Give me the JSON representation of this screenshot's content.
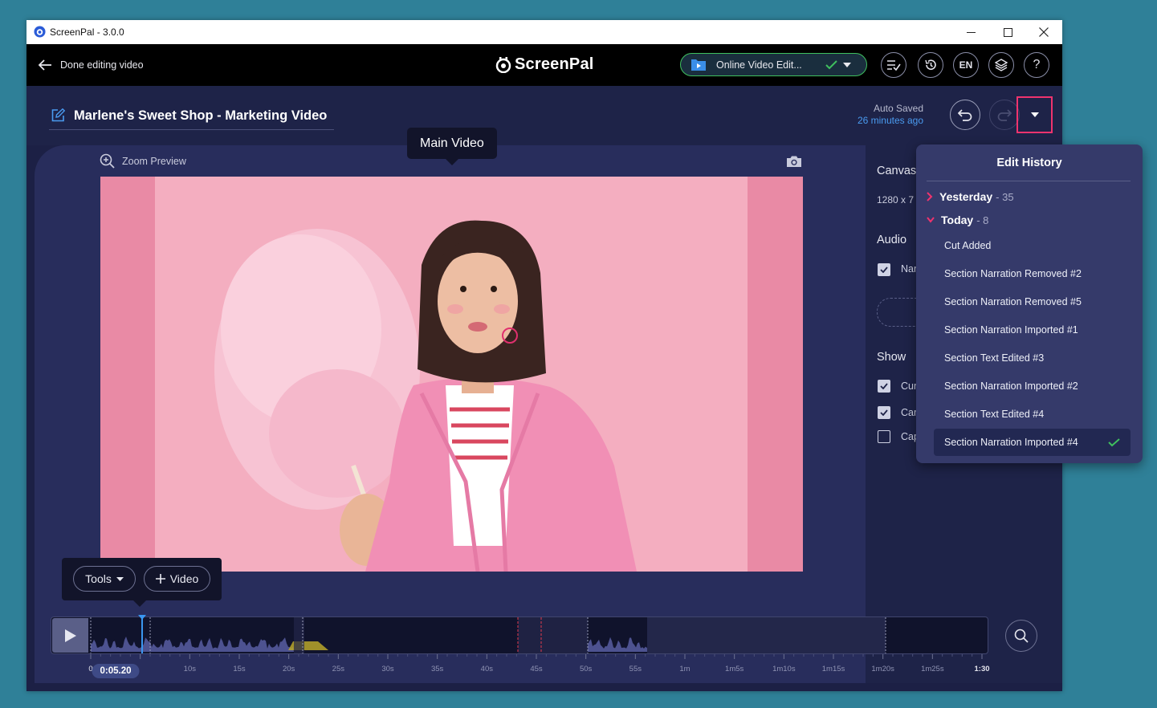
{
  "window": {
    "title": "ScreenPal - 3.0.0"
  },
  "topbar": {
    "back_label": "Done editing video",
    "logo_text": "ScreenPal",
    "project_dropdown": "Online Video Edit...",
    "language": "EN"
  },
  "project": {
    "title": "Marlene's Sweet Shop - Marketing Video",
    "auto_saved_label": "Auto Saved",
    "auto_saved_time": "26 minutes ago"
  },
  "preview": {
    "zoom_label": "Zoom Preview",
    "tooltip": "Main Video"
  },
  "right_panel": {
    "canvas_label": "Canvas",
    "canvas_size": "1280 x 7",
    "audio_label": "Audio",
    "audio_items": [
      {
        "label": "Nar",
        "checked": true
      }
    ],
    "show_label": "Show",
    "show_items": [
      {
        "label": "Cur",
        "checked": true
      },
      {
        "label": "Car",
        "checked": true
      },
      {
        "label": "Cap",
        "checked": false
      }
    ]
  },
  "edit_history": {
    "title": "Edit History",
    "groups": [
      {
        "name": "Yesterday",
        "count": "- 35",
        "expanded": false
      },
      {
        "name": "Today",
        "count": "- 8",
        "expanded": true
      }
    ],
    "items": [
      {
        "label": "Cut Added"
      },
      {
        "label": "Section Narration Removed #2"
      },
      {
        "label": "Section Narration Removed #5"
      },
      {
        "label": "Section Narration Imported #1"
      },
      {
        "label": "Section Text Edited #3"
      },
      {
        "label": "Section Narration Imported #2"
      },
      {
        "label": "Section Text Edited #4"
      },
      {
        "label": "Section Narration Imported #4",
        "selected": true
      }
    ]
  },
  "tools": {
    "tools_label": "Tools",
    "video_label": "Video"
  },
  "timeline": {
    "current_time": "0:05.20",
    "playhead_fraction": 0.0577,
    "ticks": [
      "0",
      "5s",
      "10s",
      "15s",
      "20s",
      "25s",
      "30s",
      "35s",
      "40s",
      "45s",
      "50s",
      "55s",
      "1m",
      "1m5s",
      "1m10s",
      "1m15s",
      "1m20s",
      "1m25s",
      "1:30"
    ]
  },
  "colors": {
    "accent_pink": "#f0336e",
    "accent_green": "#3fbf5e",
    "panel_bg": "#353a6a",
    "app_bg": "#1c2045"
  }
}
